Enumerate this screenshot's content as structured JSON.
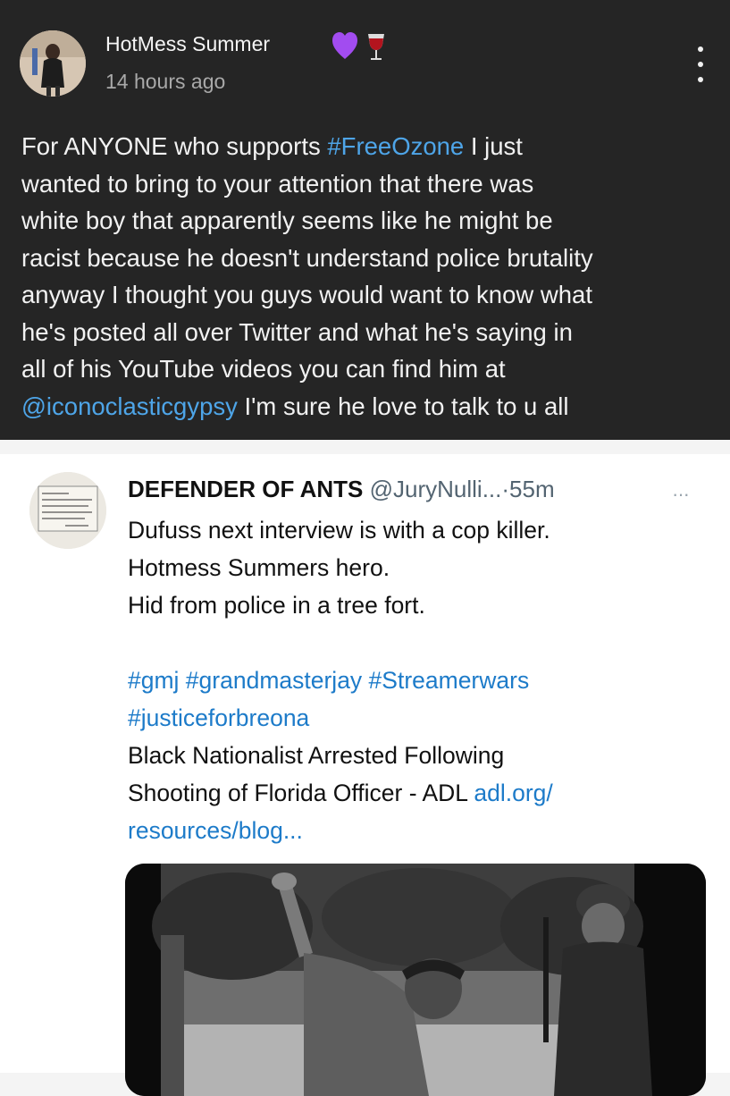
{
  "post": {
    "author": "HotMess Summer",
    "author_emojis": [
      "purple-heart",
      "wine-glass"
    ],
    "time": "14 hours ago",
    "body_lines": [
      {
        "pre": "For ANYONE who supports  ",
        "link": "#FreeOzone",
        "post": " I just"
      },
      {
        "pre": "wanted to bring to your attention that there was"
      },
      {
        "pre": "white boy that apparently seems like he might be"
      },
      {
        "pre": "racist because he doesn't understand police brutality"
      },
      {
        "pre": "anyway I thought you guys would want to know what"
      },
      {
        "pre": "he's posted all over Twitter and what he's saying in"
      },
      {
        "pre": "all of his YouTube videos you can find him at"
      },
      {
        "link": "@iconoclasticgypsy",
        "post": " I'm sure he love to talk to u all"
      }
    ]
  },
  "tweet": {
    "name": "DEFENDER OF ANTS",
    "handle": "@JuryNulli...",
    "separator": "·",
    "time": "55m",
    "more": "···",
    "text_lines": [
      "Dufuss next interview is with a cop killer.",
      "Hotmess Summers hero.",
      "Hid from police in a tree fort."
    ],
    "hashtag_lines": [
      "#gmj #grandmasterjay #Streamerwars",
      "#justiceforbreona"
    ],
    "headline_lines": [
      "Black Nationalist Arrested Following",
      "Shooting of Florida Officer - ADL "
    ],
    "link_part1": "adl.org/",
    "link_part2": "resources/blog..."
  },
  "colors": {
    "post_bg": "#252525",
    "link_blue": "#4ea5e8",
    "tweet_link_blue": "#1d7bc9"
  }
}
